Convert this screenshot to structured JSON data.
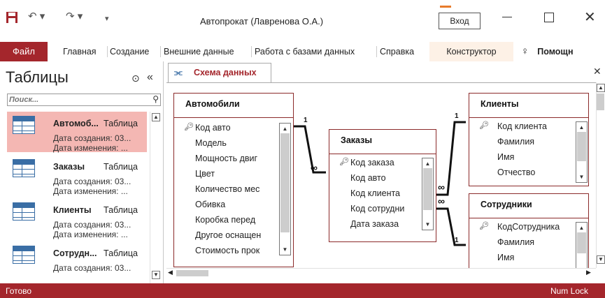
{
  "app": {
    "title": "Автопрокат (Лавренова О.А.)",
    "sign_in": "Вход",
    "undo_glyph": "↶ ▾",
    "redo_glyph": "↷ ▾",
    "qat_more": "▾"
  },
  "ribbon": {
    "file": "Файл",
    "tabs": [
      "Главная",
      "Создание",
      "Внешние данные",
      "Работа с базами данных",
      "Справка"
    ],
    "contextual_tab": "Конструктор",
    "help": "Помощн"
  },
  "nav": {
    "title": "Таблицы",
    "search_placeholder": "Поиск...",
    "items": [
      {
        "name": "Автомоб...",
        "type": "Таблица",
        "created": "Дата создания: 03...",
        "modified": "Дата изменения: ...",
        "selected": true
      },
      {
        "name": "Заказы",
        "type": "Таблица",
        "created": "Дата создания: 03...",
        "modified": "Дата изменения: ...",
        "selected": false
      },
      {
        "name": "Клиенты",
        "type": "Таблица",
        "created": "Дата создания: 03...",
        "modified": "Дата изменения: ...",
        "selected": false
      },
      {
        "name": "Сотрудн...",
        "type": "Таблица",
        "created": "Дата создания: 03...",
        "modified": "",
        "selected": false
      }
    ]
  },
  "doc": {
    "tab_label": "Схема данных",
    "tables": {
      "cars": {
        "title": "Автомобили",
        "fields": [
          "Код авто",
          "Модель",
          "Мощность двиг",
          "Цвет",
          "Количество мес",
          "Обивка",
          "Коробка перед",
          "Другое оснащен",
          "Стоимость прок"
        ]
      },
      "orders": {
        "title": "Заказы",
        "fields": [
          "Код заказа",
          "Код авто",
          "Код клиента",
          "Код сотрудни",
          "Дата заказа"
        ]
      },
      "clients": {
        "title": "Клиенты",
        "fields": [
          "Код клиента",
          "Фамилия",
          "Имя",
          "Отчество"
        ]
      },
      "staff": {
        "title": "Сотрудники",
        "fields": [
          "КодСотрудника",
          "Фамилия",
          "Имя"
        ]
      }
    },
    "rel_labels": {
      "one": "1",
      "many": "∞"
    }
  },
  "status": {
    "left": "Готово",
    "right": "Num Lock"
  },
  "colors": {
    "accent": "#a4262c",
    "selection": "#f4b7b3",
    "border": "#8b2a2a"
  }
}
